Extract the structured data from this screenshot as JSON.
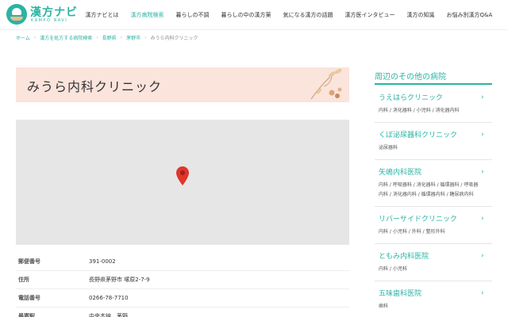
{
  "header": {
    "logo_title": "漢方ナビ",
    "logo_sub": "KAMPO NAVI",
    "nav": [
      {
        "label": "漢方ナビとは",
        "active": false
      },
      {
        "label": "漢方病院検索",
        "active": true
      },
      {
        "label": "暮らしの不調",
        "active": false
      },
      {
        "label": "暮らしの中の漢方薬",
        "active": false
      },
      {
        "label": "気になる漢方の話題",
        "active": false
      },
      {
        "label": "漢方医インタビュー",
        "active": false
      },
      {
        "label": "漢方の知識",
        "active": false
      },
      {
        "label": "お悩み別漢方Q&A",
        "active": false
      }
    ]
  },
  "breadcrumb": [
    "ホーム",
    "漢方を処方する病院検索",
    "長野県",
    "茅野市",
    "みうら内科クリニック"
  ],
  "clinic": {
    "name": "みうら内科クリニック"
  },
  "info": [
    {
      "label": "郵便番号",
      "value": "391-0002"
    },
    {
      "label": "住所",
      "value": "長野県茅野市 塚原2-7-9"
    },
    {
      "label": "電話番号",
      "value": "0266-78-7710"
    },
    {
      "label": "最寄駅",
      "value": "中央本線　茅野"
    }
  ],
  "sidebar": {
    "title": "周辺のその他の病院",
    "items": [
      {
        "name": "うえはらクリニック",
        "tags": "内科 / 消化器科 / 小児科 / 消化器内科"
      },
      {
        "name": "くぼ泌尿器科クリニック",
        "tags": "泌尿器科"
      },
      {
        "name": "矢嶋内科医院",
        "tags": "内科 / 呼吸器科 / 消化器科 / 循環器科 / 呼吸器内科 / 消化器内科 / 循環器内科 / 糖尿病内科"
      },
      {
        "name": "リバーサイドクリニック",
        "tags": "内科 / 小児科 / 外科 / 整形外科"
      },
      {
        "name": "ともみ内科医院",
        "tags": "内科 / 小児科"
      },
      {
        "name": "五味歯科医院",
        "tags": "歯科"
      }
    ]
  },
  "colors": {
    "accent": "#2bb3a3",
    "banner": "#fbe4dc",
    "pin": "#e0352b",
    "map": "#e6e6e6"
  },
  "icons": {
    "logo": "kampo-pot-logo-icon",
    "banner_art": "herb-illustration-icon",
    "map_marker": "map-pin-icon",
    "list_arrow": "chevron-right-icon"
  }
}
